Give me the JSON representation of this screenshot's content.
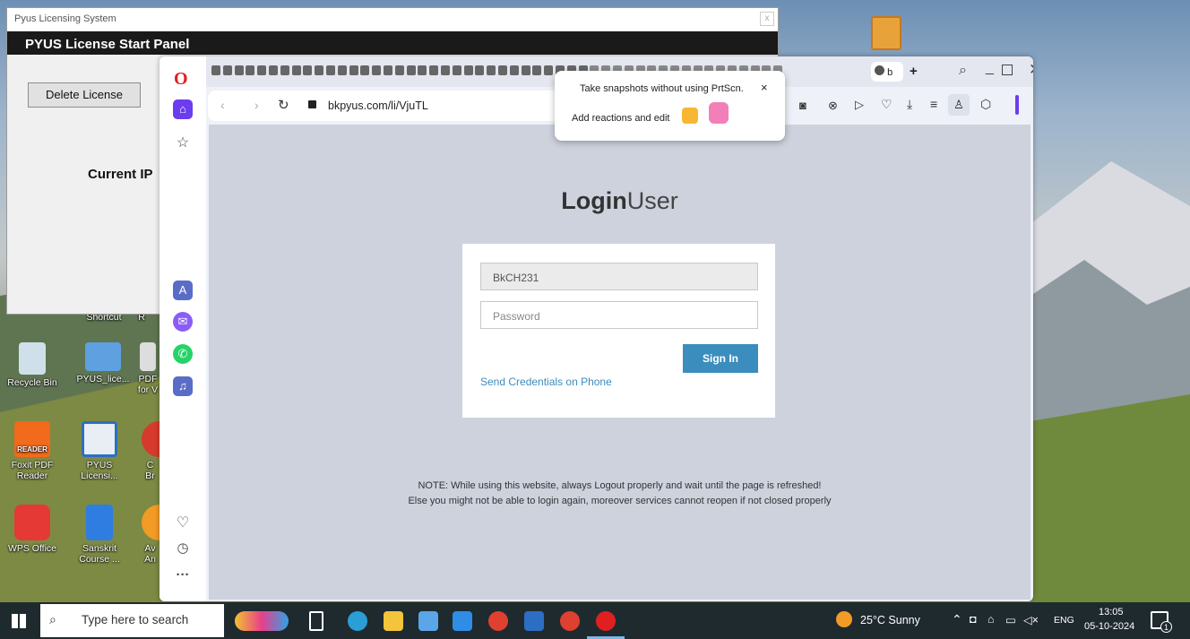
{
  "pyus_window": {
    "title": "Pyus Licensing System",
    "close": "x",
    "header": "PYUS License Start Panel",
    "delete_label": "Delete License",
    "current_ip_label": "Current IP"
  },
  "desktop_icons": {
    "shortcut_label": "Shortcut",
    "shortcut2_label": "R",
    "recycle_label": "Recycle Bin",
    "pyus_lice_label": "PYUS_lice...",
    "pdf_label": "PDF\nfor V",
    "foxit_label": "Foxit PDF Reader",
    "foxit_badge": "READER",
    "pyus_licensi_label": "PYUS Licensi...",
    "c_br_label": "C\nBr",
    "wps_label": "WPS Office",
    "sanskrit_label": "Sanskrit Course ...",
    "ava_label": "Av\nAn"
  },
  "browser": {
    "opera_logo": "O",
    "tab_label": "b",
    "new_tab": "+",
    "url": "bkpyus.com/li/VjuTL",
    "tooltip": {
      "line1": "Take snapshots without using PrtScn.",
      "line2": "Add reactions and edit",
      "close": "×"
    },
    "sidebar_more": "···"
  },
  "login_page": {
    "title_bold": "Login",
    "title_light": "User",
    "username_value": "BkCH231",
    "password_placeholder": "Password",
    "signin_label": "Sign In",
    "send_credentials_label": "Send Credentials on Phone",
    "note_line1": "NOTE: While using this website, always Logout properly and wait until the page is refreshed!",
    "note_line2": "Else you might not be able to login again, moreover services cannot reopen if not closed properly"
  },
  "taskbar": {
    "search_placeholder": "Type here to search",
    "weather": "25°C  Sunny",
    "language": "ENG",
    "time": "13:05",
    "date": "05-10-2024",
    "notification_count": "1"
  }
}
